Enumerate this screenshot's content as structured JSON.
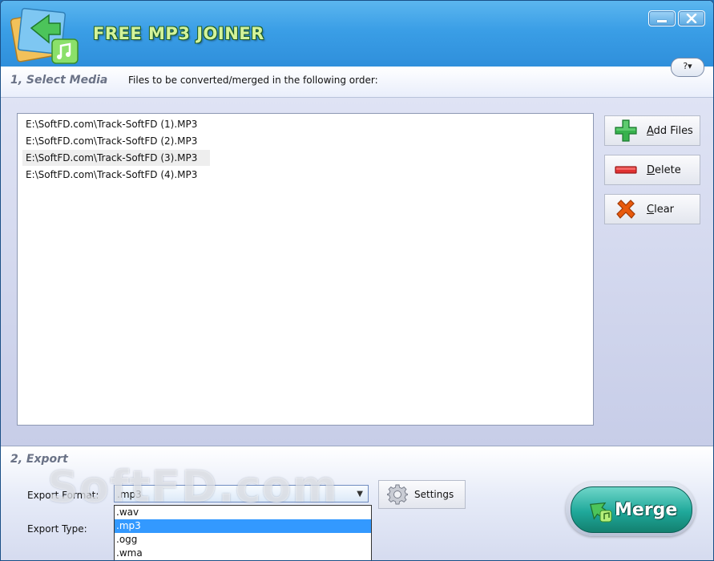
{
  "app": {
    "title": "FREE MP3 JOINER",
    "help_label": "?▾"
  },
  "select_media": {
    "title": "1, Select Media",
    "caption": "Files to be converted/merged in the following order:",
    "files": [
      "E:\\SoftFD.com\\Track-SoftFD (1).MP3",
      "E:\\SoftFD.com\\Track-SoftFD (2).MP3",
      "E:\\SoftFD.com\\Track-SoftFD (3).MP3",
      "E:\\SoftFD.com\\Track-SoftFD (4).MP3"
    ],
    "selected_index": 2,
    "buttons": {
      "add_files": {
        "mnemonic": "A",
        "rest": "dd Files",
        "icon": "plus-icon"
      },
      "delete": {
        "mnemonic": "D",
        "rest": "elete",
        "icon": "minus-icon"
      },
      "clear": {
        "mnemonic": "C",
        "rest": "lear",
        "icon": "x-icon"
      }
    }
  },
  "export": {
    "title": "2, Export",
    "format_label": "Export Format:",
    "type_label": "Export Type:",
    "format_value": ".mp3",
    "format_options": [
      ".wav",
      ".mp3",
      ".ogg",
      ".wma"
    ],
    "selected_option_index": 1,
    "settings_label": "Settings",
    "merge_label": "Merge"
  },
  "watermark": "SoftFD.com",
  "colors": {
    "title_bar": "#3a9ee6",
    "title_text": "#d4f39a",
    "selection": "#3399ff",
    "merge_button": "#1fa89a",
    "add_icon": "#37b24d",
    "delete_icon": "#e03131",
    "clear_icon": "#e8590c"
  }
}
